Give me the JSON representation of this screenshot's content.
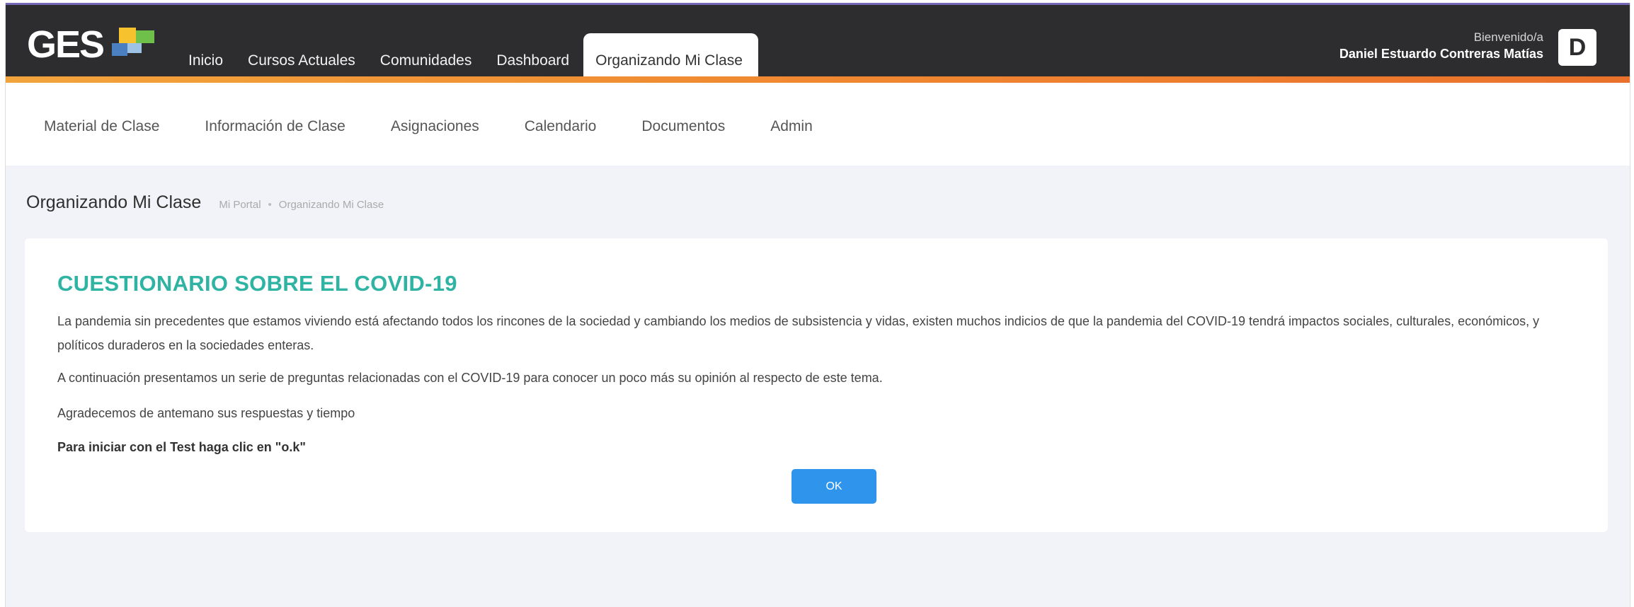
{
  "header": {
    "logo_text": "GES",
    "nav": [
      {
        "label": "Inicio"
      },
      {
        "label": "Cursos Actuales"
      },
      {
        "label": "Comunidades"
      },
      {
        "label": "Dashboard"
      },
      {
        "label": "Organizando Mi Clase",
        "active": true
      }
    ],
    "welcome_label": "Bienvenido/a",
    "user_name": "Daniel Estuardo Contreras Matías",
    "avatar_initial": "D"
  },
  "subnav": [
    {
      "label": "Material de Clase"
    },
    {
      "label": "Información de Clase"
    },
    {
      "label": "Asignaciones"
    },
    {
      "label": "Calendario"
    },
    {
      "label": "Documentos"
    },
    {
      "label": "Admin"
    }
  ],
  "page": {
    "title": "Organizando Mi Clase",
    "breadcrumb": [
      "Mi Portal",
      "Organizando Mi Clase"
    ]
  },
  "card": {
    "title": "CUESTIONARIO SOBRE EL COVID-19",
    "paragraph1": "La pandemia sin precedentes que estamos viviendo está afectando todos los rincones de la sociedad y cambiando los medios de subsistencia y vidas, existen muchos indicios de que la pandemia del COVID-19 tendrá impactos sociales, culturales, económicos, y políticos duraderos en la sociedades enteras.",
    "paragraph2": "A continuación presentamos un serie de preguntas relacionadas con el COVID-19 para conocer un poco más su opinión al respecto de este tema.",
    "paragraph3": "Agradecemos de antemano sus respuestas y tiempo",
    "instruction": "Para iniciar con el Test haga clic en \"o.k\"",
    "ok_label": "OK"
  },
  "colors": {
    "header_bg": "#2d2d30",
    "accent_stripe": "#f08a32",
    "card_title": "#2fb3a3",
    "ok_button": "#2e94ec"
  }
}
